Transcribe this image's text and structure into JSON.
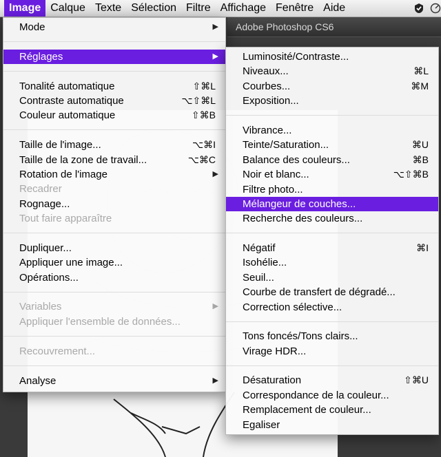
{
  "menubar": {
    "items": [
      "Image",
      "Calque",
      "Texte",
      "Sélection",
      "Filtre",
      "Affichage",
      "Fenêtre",
      "Aide"
    ]
  },
  "app": {
    "title": "Adobe Photoshop CS6"
  },
  "main_menu": {
    "items": [
      {
        "label": "Mode",
        "shortcut": "",
        "arrow": true,
        "disabled": false,
        "highlighted": false
      },
      {
        "label": "Réglages",
        "shortcut": "",
        "arrow": true,
        "disabled": false,
        "highlighted": true
      },
      {
        "label": "Tonalité automatique",
        "shortcut": "⇧⌘L",
        "arrow": false,
        "disabled": false,
        "highlighted": false
      },
      {
        "label": "Contraste automatique",
        "shortcut": "⌥⇧⌘L",
        "arrow": false,
        "disabled": false,
        "highlighted": false
      },
      {
        "label": "Couleur automatique",
        "shortcut": "⇧⌘B",
        "arrow": false,
        "disabled": false,
        "highlighted": false
      },
      {
        "label": "Taille de l'image...",
        "shortcut": "⌥⌘I",
        "arrow": false,
        "disabled": false,
        "highlighted": false
      },
      {
        "label": "Taille de la zone de travail...",
        "shortcut": "⌥⌘C",
        "arrow": false,
        "disabled": false,
        "highlighted": false
      },
      {
        "label": "Rotation de l'image",
        "shortcut": "",
        "arrow": true,
        "disabled": false,
        "highlighted": false
      },
      {
        "label": "Recadrer",
        "shortcut": "",
        "arrow": false,
        "disabled": true,
        "highlighted": false
      },
      {
        "label": "Rognage...",
        "shortcut": "",
        "arrow": false,
        "disabled": false,
        "highlighted": false
      },
      {
        "label": "Tout faire apparaître",
        "shortcut": "",
        "arrow": false,
        "disabled": true,
        "highlighted": false
      },
      {
        "label": "Dupliquer...",
        "shortcut": "",
        "arrow": false,
        "disabled": false,
        "highlighted": false
      },
      {
        "label": "Appliquer une image...",
        "shortcut": "",
        "arrow": false,
        "disabled": false,
        "highlighted": false
      },
      {
        "label": "Opérations...",
        "shortcut": "",
        "arrow": false,
        "disabled": false,
        "highlighted": false
      },
      {
        "label": "Variables",
        "shortcut": "",
        "arrow": true,
        "disabled": true,
        "highlighted": false
      },
      {
        "label": "Appliquer l'ensemble de données...",
        "shortcut": "",
        "arrow": false,
        "disabled": true,
        "highlighted": false
      },
      {
        "label": "Recouvrement...",
        "shortcut": "",
        "arrow": false,
        "disabled": true,
        "highlighted": false
      },
      {
        "label": "Analyse",
        "shortcut": "",
        "arrow": true,
        "disabled": false,
        "highlighted": false
      }
    ]
  },
  "sub_menu": {
    "items": [
      {
        "label": "Luminosité/Contraste...",
        "shortcut": "",
        "highlighted": false
      },
      {
        "label": "Niveaux...",
        "shortcut": "⌘L",
        "highlighted": false
      },
      {
        "label": "Courbes...",
        "shortcut": "⌘M",
        "highlighted": false
      },
      {
        "label": "Exposition...",
        "shortcut": "",
        "highlighted": false
      },
      {
        "label": "Vibrance...",
        "shortcut": "",
        "highlighted": false
      },
      {
        "label": "Teinte/Saturation...",
        "shortcut": "⌘U",
        "highlighted": false
      },
      {
        "label": "Balance des couleurs...",
        "shortcut": "⌘B",
        "highlighted": false
      },
      {
        "label": "Noir et blanc...",
        "shortcut": "⌥⇧⌘B",
        "highlighted": false
      },
      {
        "label": "Filtre photo...",
        "shortcut": "",
        "highlighted": false
      },
      {
        "label": "Mélangeur de couches...",
        "shortcut": "",
        "highlighted": true
      },
      {
        "label": "Recherche des couleurs...",
        "shortcut": "",
        "highlighted": false
      },
      {
        "label": "Négatif",
        "shortcut": "⌘I",
        "highlighted": false
      },
      {
        "label": "Isohélie...",
        "shortcut": "",
        "highlighted": false
      },
      {
        "label": "Seuil...",
        "shortcut": "",
        "highlighted": false
      },
      {
        "label": "Courbe de transfert de dégradé...",
        "shortcut": "",
        "highlighted": false
      },
      {
        "label": "Correction sélective...",
        "shortcut": "",
        "highlighted": false
      },
      {
        "label": "Tons foncés/Tons clairs...",
        "shortcut": "",
        "highlighted": false
      },
      {
        "label": "Virage HDR...",
        "shortcut": "",
        "highlighted": false
      },
      {
        "label": "Désaturation",
        "shortcut": "⇧⌘U",
        "highlighted": false
      },
      {
        "label": "Correspondance de la couleur...",
        "shortcut": "",
        "highlighted": false
      },
      {
        "label": "Remplacement de couleur...",
        "shortcut": "",
        "highlighted": false
      },
      {
        "label": "Egaliser",
        "shortcut": "",
        "highlighted": false
      }
    ]
  },
  "colors": {
    "highlight": "#6a1ee0"
  }
}
